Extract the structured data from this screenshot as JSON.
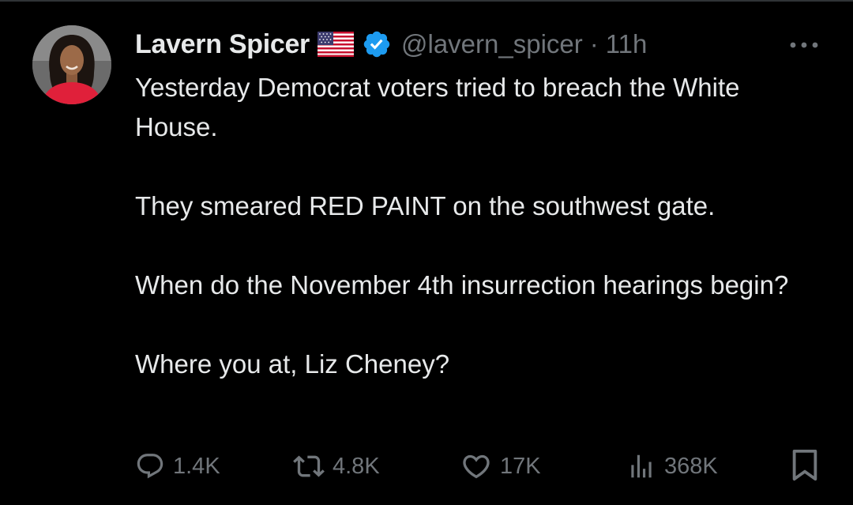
{
  "tweet": {
    "author": {
      "display_name": "Lavern Spicer",
      "handle": "@lavern_spicer",
      "flag_icon": "us-flag-icon",
      "verified_icon": "verified-badge-icon",
      "verified_color": "#1d9bf0"
    },
    "separator": "·",
    "time": "11h",
    "more_icon": "more-icon",
    "paragraphs": [
      "Yesterday Democrat voters tried to breach the White House.",
      "They smeared RED PAINT on the southwest gate.",
      "When do the November 4th insurrection hearings begin?",
      "Where you at, Liz Cheney?"
    ],
    "actions": {
      "reply": {
        "icon": "reply-icon",
        "count": "1.4K"
      },
      "retweet": {
        "icon": "retweet-icon",
        "count": "4.8K"
      },
      "like": {
        "icon": "heart-icon",
        "count": "17K"
      },
      "views": {
        "icon": "views-icon",
        "count": "368K"
      },
      "bookmark": {
        "icon": "bookmark-icon"
      }
    }
  },
  "colors": {
    "background": "#000000",
    "text_primary": "#e7e9ea",
    "text_secondary": "#71767b",
    "divider": "#2f3336"
  }
}
